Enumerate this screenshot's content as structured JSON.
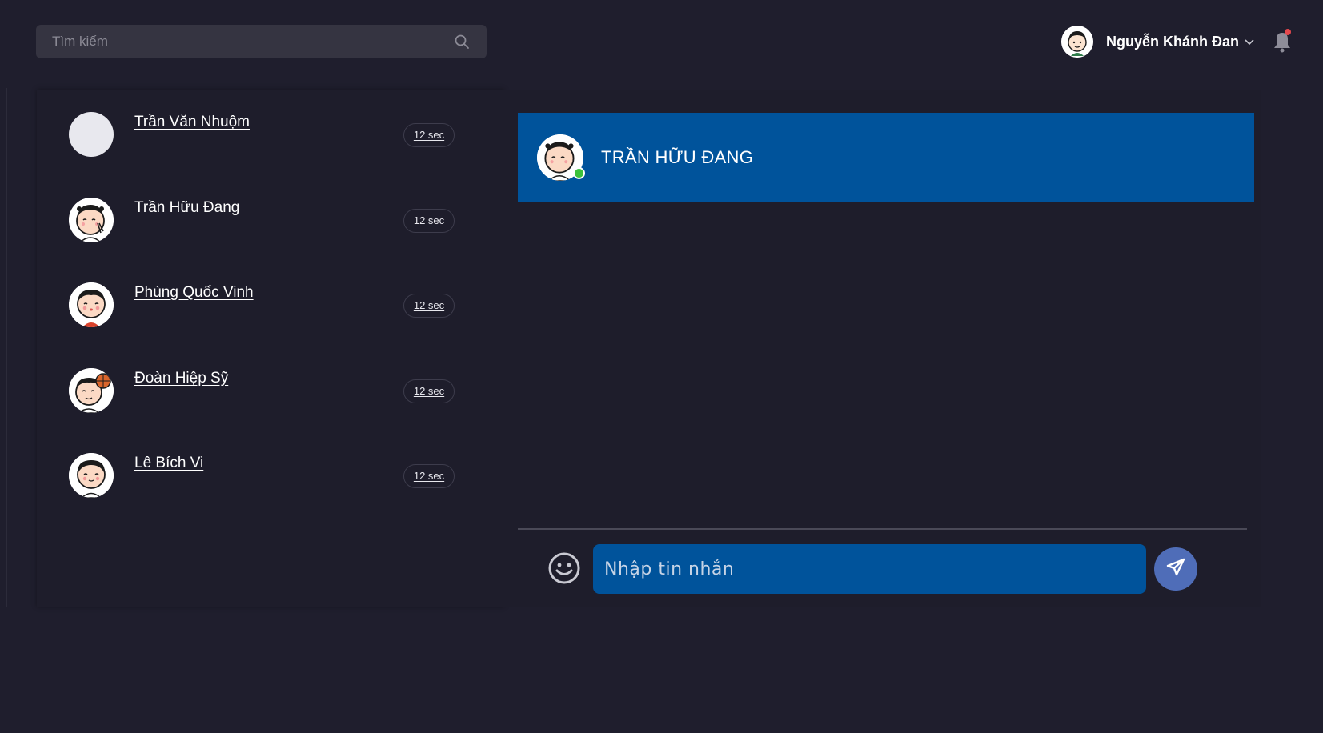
{
  "search": {
    "placeholder": "Tìm kiếm",
    "icon": "search-icon"
  },
  "user": {
    "name": "Nguyễn Khánh Đan",
    "menu_icon": "chevron-down-icon"
  },
  "notifications": {
    "icon": "bell-icon",
    "has_unread": true,
    "badge_color": "#e5484d"
  },
  "contacts": [
    {
      "name": "Trần Văn Nhuộm",
      "time": "12 sec",
      "avatar": "blank-avatar"
    },
    {
      "name": "Trần Hữu Đang",
      "time": "12 sec",
      "avatar": "cartoon-avatar"
    },
    {
      "name": "Phùng Quốc Vinh",
      "time": "12 sec",
      "avatar": "cartoon-avatar"
    },
    {
      "name": "Đoàn Hiệp Sỹ",
      "time": "12 sec",
      "avatar": "cartoon-avatar"
    },
    {
      "name": "Lê Bích Vi",
      "time": "12 sec",
      "avatar": "cartoon-avatar"
    }
  ],
  "chat": {
    "header_name": "TRẦN HỮU ĐANG",
    "status": "online",
    "status_color": "#3cc13b",
    "input_placeholder": "Nhập tin nhắn",
    "emoji_icon": "smiley-icon",
    "send_icon": "send-icon"
  },
  "colors": {
    "background": "#1f1e2d",
    "accent": "#00539b",
    "send_button": "#4f6db8"
  }
}
